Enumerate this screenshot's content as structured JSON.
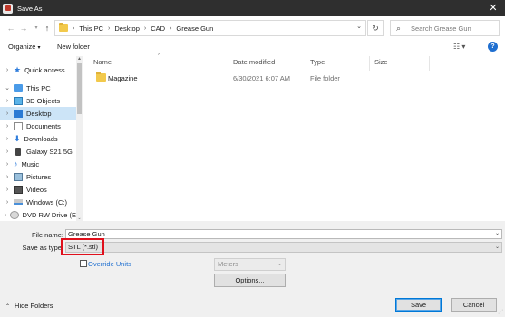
{
  "window": {
    "title": "Save As",
    "close_glyph": "✕"
  },
  "address": {
    "crumbs": [
      "This PC",
      "Desktop",
      "CAD",
      "Grease Gun"
    ],
    "search_placeholder": "Search Grease Gun"
  },
  "toolbar": {
    "organize_label": "Organize",
    "new_folder_label": "New folder"
  },
  "nav": {
    "items": [
      {
        "label": "Quick access",
        "icon": "star-icon"
      },
      {
        "label": "This PC",
        "icon": "computer-icon"
      },
      {
        "label": "3D Objects",
        "icon": "cube-icon"
      },
      {
        "label": "Desktop",
        "icon": "desktop-icon",
        "selected": true
      },
      {
        "label": "Documents",
        "icon": "document-icon"
      },
      {
        "label": "Downloads",
        "icon": "download-icon"
      },
      {
        "label": "Galaxy S21 5G",
        "icon": "phone-icon"
      },
      {
        "label": "Music",
        "icon": "music-icon"
      },
      {
        "label": "Pictures",
        "icon": "pictures-icon"
      },
      {
        "label": "Videos",
        "icon": "video-icon"
      },
      {
        "label": "Windows (C:)",
        "icon": "drive-icon"
      },
      {
        "label": "DVD RW Drive (E",
        "icon": "dvd-icon"
      }
    ]
  },
  "file_list": {
    "columns": [
      "Name",
      "Date modified",
      "Type",
      "Size"
    ],
    "rows": [
      {
        "name": "Magazine",
        "date_modified": "6/30/2021 6:07 AM",
        "type": "File folder",
        "size": ""
      }
    ]
  },
  "form": {
    "file_name_label": "File name:",
    "file_name_value": "Grease Gun",
    "save_as_type_label": "Save as type:",
    "save_as_type_value": "STL (*.stl)",
    "override_units_label": "Override Units",
    "units_value": "Meters",
    "options_label": "Options...",
    "hide_folders_label": "Hide Folders",
    "save_label": "Save",
    "cancel_label": "Cancel"
  },
  "colors": {
    "title_bar": "#2f2f2f",
    "accent": "#1f6fd0",
    "highlight_box": "#e0101c",
    "selection": "#cce4f7"
  }
}
